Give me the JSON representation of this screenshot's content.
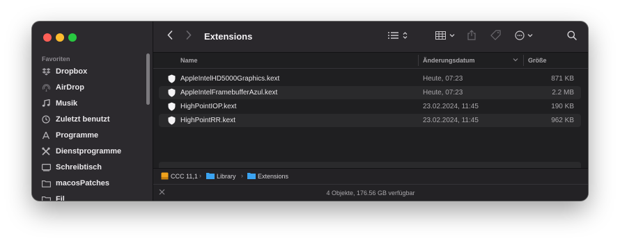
{
  "sidebar": {
    "section_title": "Favoriten",
    "items": [
      {
        "label": "Dropbox",
        "icon": "dropbox-icon"
      },
      {
        "label": "AirDrop",
        "icon": "airdrop-icon"
      },
      {
        "label": "Musik",
        "icon": "music-icon"
      },
      {
        "label": "Zuletzt benutzt",
        "icon": "clock-icon"
      },
      {
        "label": "Programme",
        "icon": "apps-icon"
      },
      {
        "label": "Dienstprogramme",
        "icon": "tools-icon"
      },
      {
        "label": "Schreibtisch",
        "icon": "desktop-icon"
      },
      {
        "label": "macosPatches",
        "icon": "folder-icon"
      },
      {
        "label": "Fil",
        "icon": "folder-icon"
      }
    ]
  },
  "toolbar": {
    "title": "Extensions",
    "back_icon": "chevron-left-icon",
    "forward_icon": "chevron-right-icon",
    "view_icon": "list-view-icon",
    "group_icon": "grid-group-icon",
    "share_icon": "share-icon",
    "tag_icon": "tag-icon",
    "more_icon": "ellipsis-circle-icon",
    "search_icon": "search-icon"
  },
  "columns": {
    "name": "Name",
    "date": "Änderungsdatum",
    "size": "Größe"
  },
  "files": [
    {
      "name": "AppleIntelHD5000Graphics.kext",
      "date": "Heute, 07:23",
      "size": "871 KB"
    },
    {
      "name": "AppleIntelFramebufferAzul.kext",
      "date": "Heute, 07:23",
      "size": "2.2 MB"
    },
    {
      "name": "HighPointIOP.kext",
      "date": "23.02.2024, 11:45",
      "size": "190 KB"
    },
    {
      "name": "HighPointRR.kext",
      "date": "23.02.2024, 11:45",
      "size": "962 KB"
    }
  ],
  "path": {
    "items": [
      "CCC 11,1",
      "Library",
      "Extensions"
    ],
    "separator": "›"
  },
  "status": {
    "text": "4 Objekte, 176.56 GB verfügbar"
  },
  "colors": {
    "close": "#fe5f57",
    "minimize": "#febc2e",
    "zoom": "#28c840",
    "folder_blue": "#3ba3f0",
    "drive_orange": "#f0a21c"
  }
}
